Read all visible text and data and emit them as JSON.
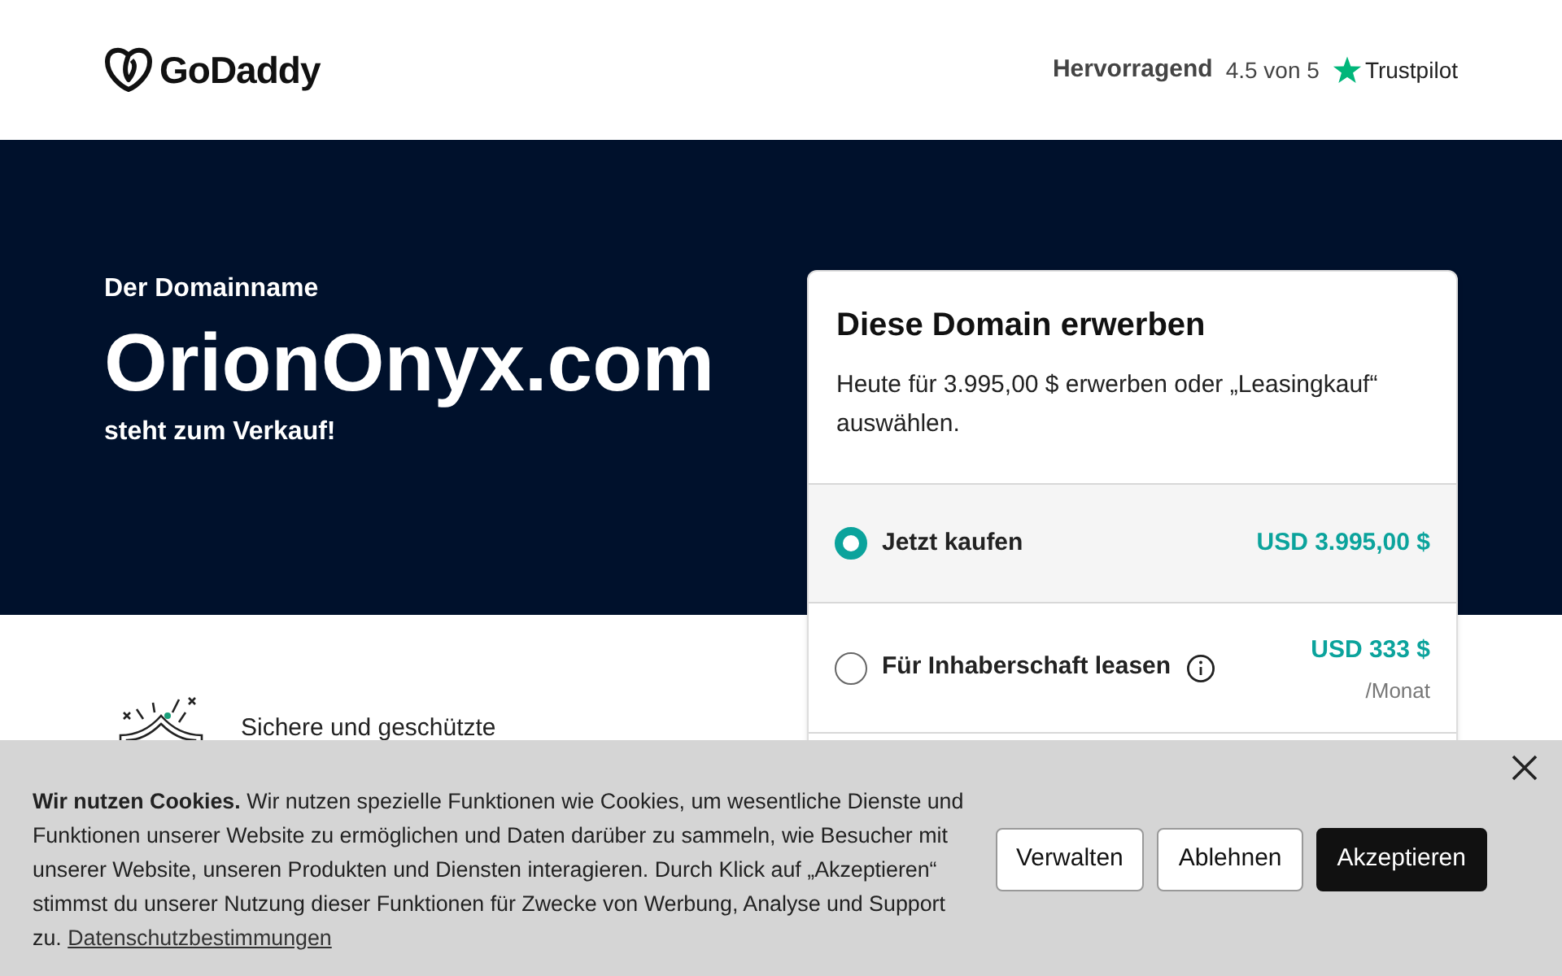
{
  "header": {
    "logo": "GoDaddy",
    "rating": {
      "label": "Hervorragend",
      "score": "4.5 von 5",
      "brand": "Trustpilot"
    }
  },
  "hero": {
    "eyebrow": "Der Domainname",
    "domain": "OrionOnyx.com",
    "subtitle": "steht zum Verkauf!"
  },
  "feature": {
    "text": "Sichere und geschützte"
  },
  "purchase_card": {
    "title": "Diese Domain erwerben",
    "description": "Heute für 3.995,00 $ erwerben oder „Leasingkauf“ auswählen.",
    "options": [
      {
        "label": "Jetzt kaufen",
        "price": "USD 3.995,00 $",
        "selected": true,
        "info": false
      },
      {
        "label": "Für Inhaberschaft leasen",
        "price": "USD 333 $",
        "period": "/Monat",
        "selected": false,
        "info": true
      }
    ]
  },
  "cookie_banner": {
    "text": "**Wir nutzen Cookies.** Wir nutzen spezielle Funktionen wie Cookies, um wesentliche Dienste und Funktionen unserer Website zu ermöglichen und Daten darüber zu sammeln, wie Besucher mit unserer Website, unseren Produkten und Diensten interagieren. Durch Klick auf „Akzeptieren“ stimmst du unserer Nutzung dieser Funktionen für Zwecke von Werbung, Analyse und Support zu.",
    "link": "Datenschutzbestimmungen",
    "buttons": [
      {
        "label": "Verwalten",
        "kind": "outline"
      },
      {
        "label": "Ablehnen",
        "kind": "outline"
      },
      {
        "label": "Akzeptieren",
        "kind": "primary"
      }
    ]
  }
}
